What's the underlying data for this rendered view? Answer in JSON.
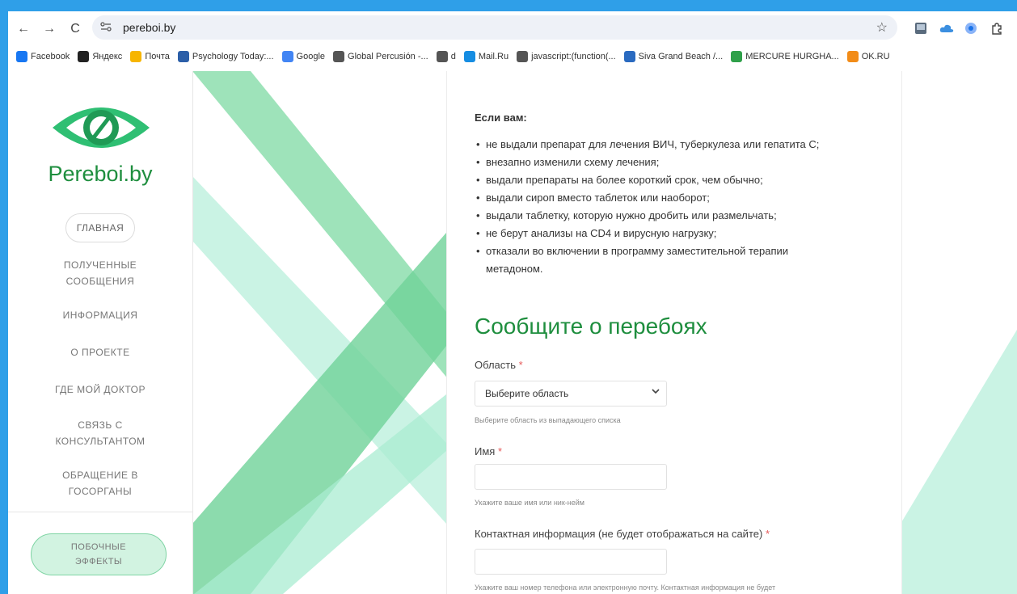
{
  "browser": {
    "url": "pereboi.by",
    "back_glyph": "←",
    "forward_glyph": "→",
    "reload_glyph": "C"
  },
  "bookmarks": [
    {
      "label": "Facebook",
      "icon": "facebook-icon",
      "color": "#1877f2"
    },
    {
      "label": "Яндекс",
      "icon": "yandex-icon",
      "color": "#222222"
    },
    {
      "label": "Почта",
      "icon": "mail-icon",
      "color": "#f7b500"
    },
    {
      "label": "Psychology Today:...",
      "icon": "pt-icon",
      "color": "#2c5fa8"
    },
    {
      "label": "Google",
      "icon": "google-icon",
      "color": "#4285f4"
    },
    {
      "label": "Global Percusión -...",
      "icon": "globe-icon",
      "color": "#555555"
    },
    {
      "label": "d",
      "icon": "globe-icon",
      "color": "#555555"
    },
    {
      "label": "Mail.Ru",
      "icon": "mailru-icon",
      "color": "#168de2"
    },
    {
      "label": "javascript:(function(...",
      "icon": "globe-icon",
      "color": "#555555"
    },
    {
      "label": "Siva Grand Beach /...",
      "icon": "hotel-icon",
      "color": "#2a6ac0"
    },
    {
      "label": "MERCURE HURGHA...",
      "icon": "mercure-icon",
      "color": "#2fa04a"
    },
    {
      "label": "OK.RU",
      "icon": "ok-icon",
      "color": "#f28c18"
    }
  ],
  "sidebar": {
    "brand": "Pereboi.by",
    "items": [
      {
        "label": "ГЛАВНАЯ",
        "active": true
      },
      {
        "label": "ПОЛУЧЕННЫЕ СООБЩЕНИЯ"
      },
      {
        "label": "ИНФОРМАЦИЯ"
      },
      {
        "label": "О ПРОЕКТЕ"
      },
      {
        "label": "ГДЕ МОЙ ДОКТОР"
      },
      {
        "label": "СВЯЗЬ С КОНСУЛЬТАНТОМ"
      },
      {
        "label": "ОБРАЩЕНИЕ В ГОСОРГАНЫ"
      }
    ],
    "side_effects_button": "ПОБОЧНЫЕ ЭФФЕКТЫ"
  },
  "content": {
    "intro": "Если вам:",
    "bullets": [
      "не выдали препарат для лечения ВИЧ, туберкулеза или гепатита С;",
      "внезапно изменили схему лечения;",
      "выдали препараты на более короткий срок, чем обычно;",
      "выдали сироп вместо таблеток или наоборот;",
      "выдали таблетку, которую нужно дробить или размельчать;",
      "не берут анализы на CD4 и вирусную нагрузку;",
      "отказали во включении в программу заместительной терапии метадоном."
    ],
    "form_title": "Сообщите о перебоях",
    "region_label": "Область",
    "required_mark": "*",
    "region_select_value": "Выберите область",
    "region_hint": "Выберите область из выпадающего списка",
    "name_label": "Имя",
    "name_hint": "Укажите ваше имя или ник-нейм",
    "contact_label": "Контактная информация (не будет отображаться на сайте)",
    "contact_hint": "Укажите ваш номер телефона или электронную почту. Контактная информация не будет"
  },
  "colors": {
    "brand_green": "#1e8e3e",
    "stripe_green": "#7ed9a3",
    "stripe_mint": "#a9ecd2"
  }
}
